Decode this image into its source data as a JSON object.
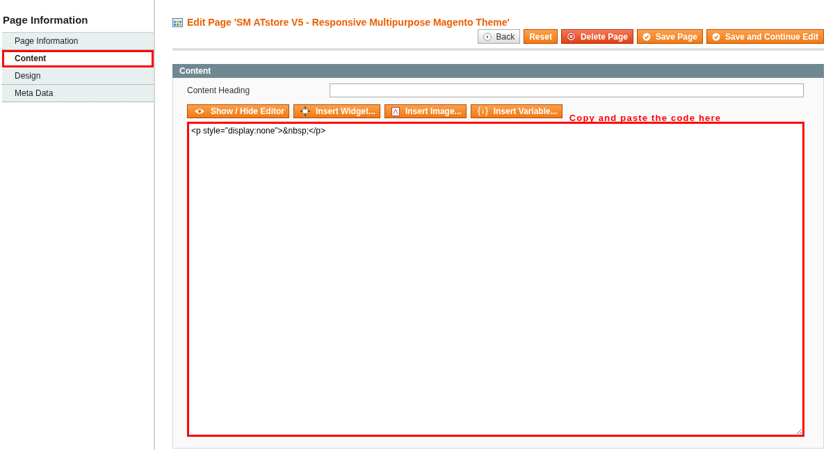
{
  "sidebar": {
    "title": "Page Information",
    "items": [
      {
        "label": "Page Information",
        "selected": false
      },
      {
        "label": "Content",
        "selected": true
      },
      {
        "label": "Design",
        "selected": false
      },
      {
        "label": "Meta Data",
        "selected": false
      }
    ]
  },
  "page_title": "Edit Page 'SM ATstore V5 - Responsive Multipurpose Magento Theme'",
  "actions": [
    {
      "label": "Back",
      "kind": "back"
    },
    {
      "label": "Reset",
      "kind": "plain"
    },
    {
      "label": "Delete Page",
      "kind": "delete"
    },
    {
      "label": "Save Page",
      "kind": "save"
    },
    {
      "label": "Save and Continue Edit",
      "kind": "save"
    }
  ],
  "section": {
    "title": "Content",
    "heading_label": "Content Heading",
    "editor_buttons": [
      "Show / Hide Editor",
      "Insert Widget...",
      "Insert Image...",
      "Insert Variable..."
    ],
    "annotation": "Copy and paste the code here",
    "editor_value": "<p style=\"display:none\">&nbsp;</p>"
  }
}
